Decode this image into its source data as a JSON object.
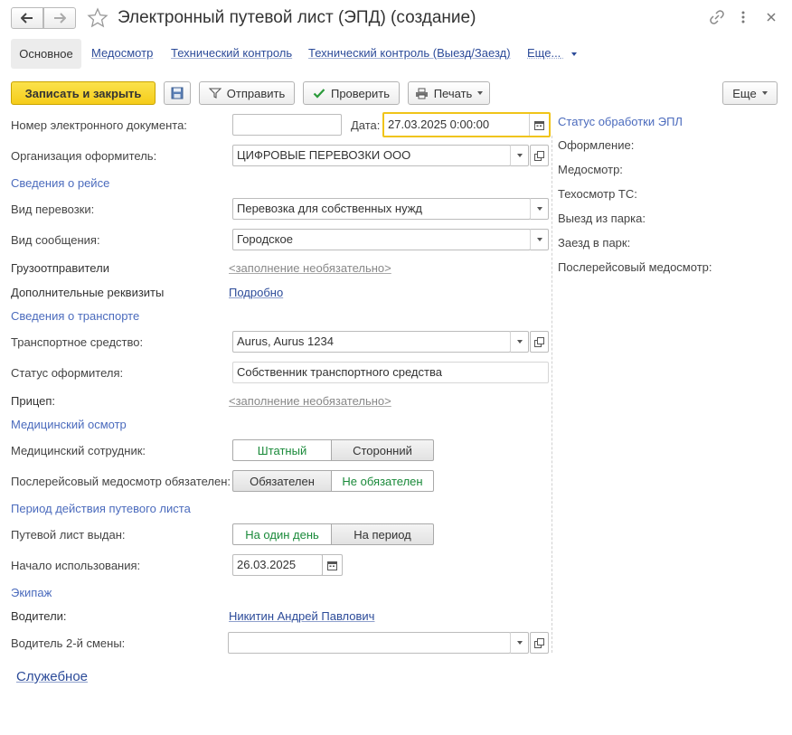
{
  "header": {
    "title": "Электронный путевой лист (ЭПД) (создание)"
  },
  "tabs": [
    {
      "label": "Основное",
      "active": true
    },
    {
      "label": "Медосмотр"
    },
    {
      "label": "Технический контроль"
    },
    {
      "label": "Технический контроль (Выезд/Заезд)"
    },
    {
      "label": "Еще..."
    }
  ],
  "toolbar": {
    "save_close": "Записать и закрыть",
    "send": "Отправить",
    "check": "Проверить",
    "print": "Печать",
    "more": "Еще"
  },
  "form": {
    "doc_number_label": "Номер электронного документа:",
    "doc_number_value": "",
    "date_label": "Дата:",
    "date_value": "27.03.2025  0:00:00",
    "org_label": "Организация оформитель:",
    "org_value": "ЦИФРОВЫЕ ПЕРЕВОЗКИ ООО",
    "section_trip": "Сведения о рейсе",
    "transport_kind_label": "Вид перевозки:",
    "transport_kind_value": "Перевозка для собственных нужд",
    "message_kind_label": "Вид сообщения:",
    "message_kind_value": "Городское",
    "shippers_label": "Грузоотправители",
    "optional_placeholder": "<заполнение необязательно>",
    "extra_label": "Дополнительные реквизиты",
    "extra_link": "Подробно",
    "section_transport": "Сведения о транспорте",
    "vehicle_label": "Транспортное средство:",
    "vehicle_value": "Aurus, Aurus 1234",
    "issuer_status_label": "Статус оформителя:",
    "issuer_status_value": "Собственник транспортного средства",
    "trailer_label": "Прицеп:",
    "section_medical": "Медицинский осмотр",
    "med_worker_label": "Медицинский сотрудник:",
    "med_worker_options": [
      "Штатный",
      "Сторонний"
    ],
    "post_trip_label": "Послерейсовый медосмотр обязателен:",
    "post_trip_options": [
      "Обязателен",
      "Не обязателен"
    ],
    "section_period": "Период действия путевого листа",
    "issued_label": "Путевой лист выдан:",
    "issued_options": [
      "На один день",
      "На период"
    ],
    "start_label": "Начало использования:",
    "start_value": "26.03.2025",
    "section_crew": "Экипаж",
    "drivers_label": "Водители:",
    "drivers_value": "Никитин Андрей Павлович",
    "driver2_label": "Водитель 2-й смены:",
    "driver2_value": "",
    "service_link": "Служебное"
  },
  "status_panel": {
    "title": "Статус обработки ЭПЛ",
    "items": [
      "Оформление:",
      "Медосмотр:",
      "Техосмотр ТС:",
      "Выезд из парка:",
      "Заезд в парк:",
      "Послерейсовый медосмотр:"
    ]
  },
  "colors": {
    "primary_button": "#f5cc1a",
    "link": "#2c4b99",
    "section": "#4b6bbd",
    "selected_option": "#1a8a3a",
    "focus_border": "#f0c419"
  }
}
